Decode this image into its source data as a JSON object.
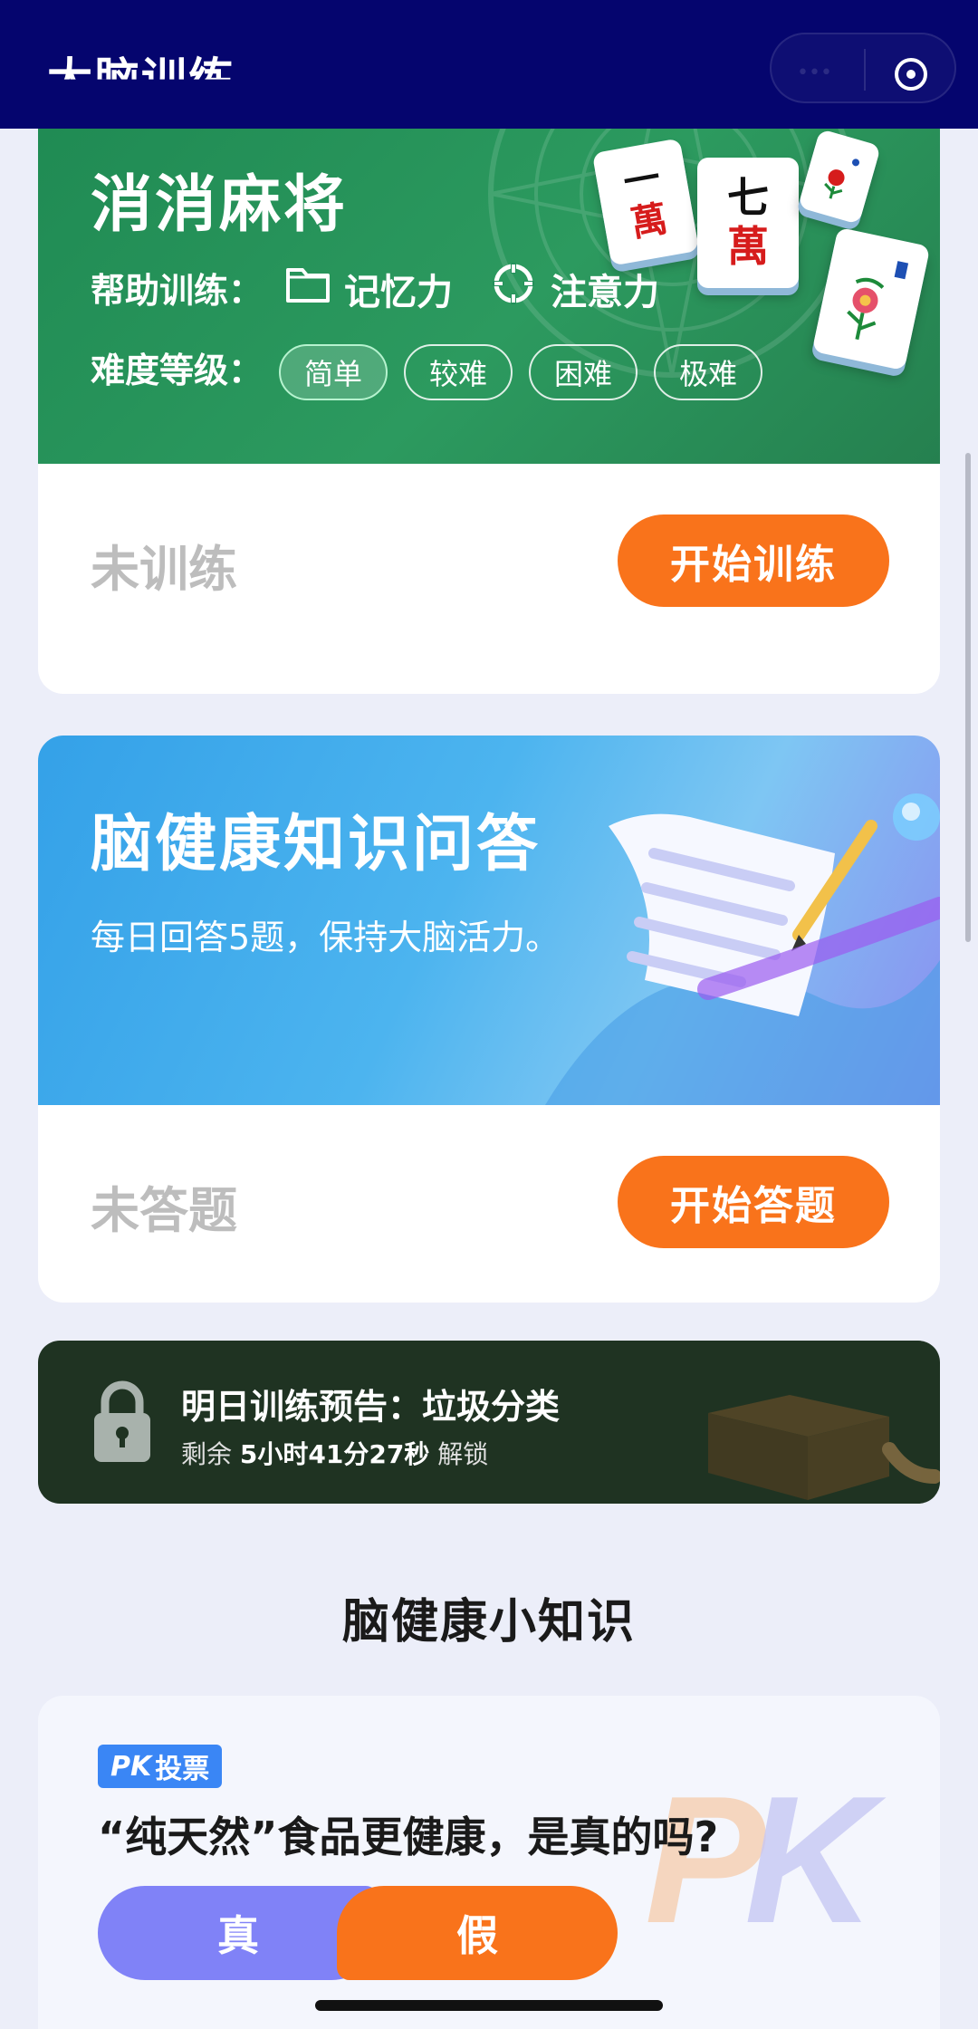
{
  "header": {
    "title": "大脑训练"
  },
  "mahjong_card": {
    "title": "消消麻将",
    "help_label": "帮助训练：",
    "skills": [
      "记忆力",
      "注意力"
    ],
    "difficulty_label": "难度等级：",
    "levels": [
      "简单",
      "较难",
      "困难",
      "极难"
    ],
    "selected_level": "简单",
    "tiles": [
      {
        "top": "一",
        "bottom": "萬"
      },
      {
        "top": "七",
        "bottom": "萬"
      }
    ],
    "status": "未训练",
    "button": "开始训练",
    "colors": {
      "banner": "#23905a",
      "button": "#f9731b"
    }
  },
  "quiz_card": {
    "title": "脑健康知识问答",
    "subtitle": "每日回答5题，保持大脑活力。",
    "status": "未答题",
    "button": "开始答题"
  },
  "lock_card": {
    "title": "明日训练预告：垃圾分类",
    "prefix": "剩余",
    "countdown": "5小时41分27秒",
    "suffix": "解锁"
  },
  "knowledge": {
    "section_title": "脑健康小知识",
    "badge_pk": "PK",
    "badge_text": "投票",
    "question": "“纯天然”食品更健康，是真的吗?",
    "true_label": "真",
    "false_label": "假",
    "colors": {
      "true": "#8082f7",
      "false": "#f9731b"
    }
  }
}
